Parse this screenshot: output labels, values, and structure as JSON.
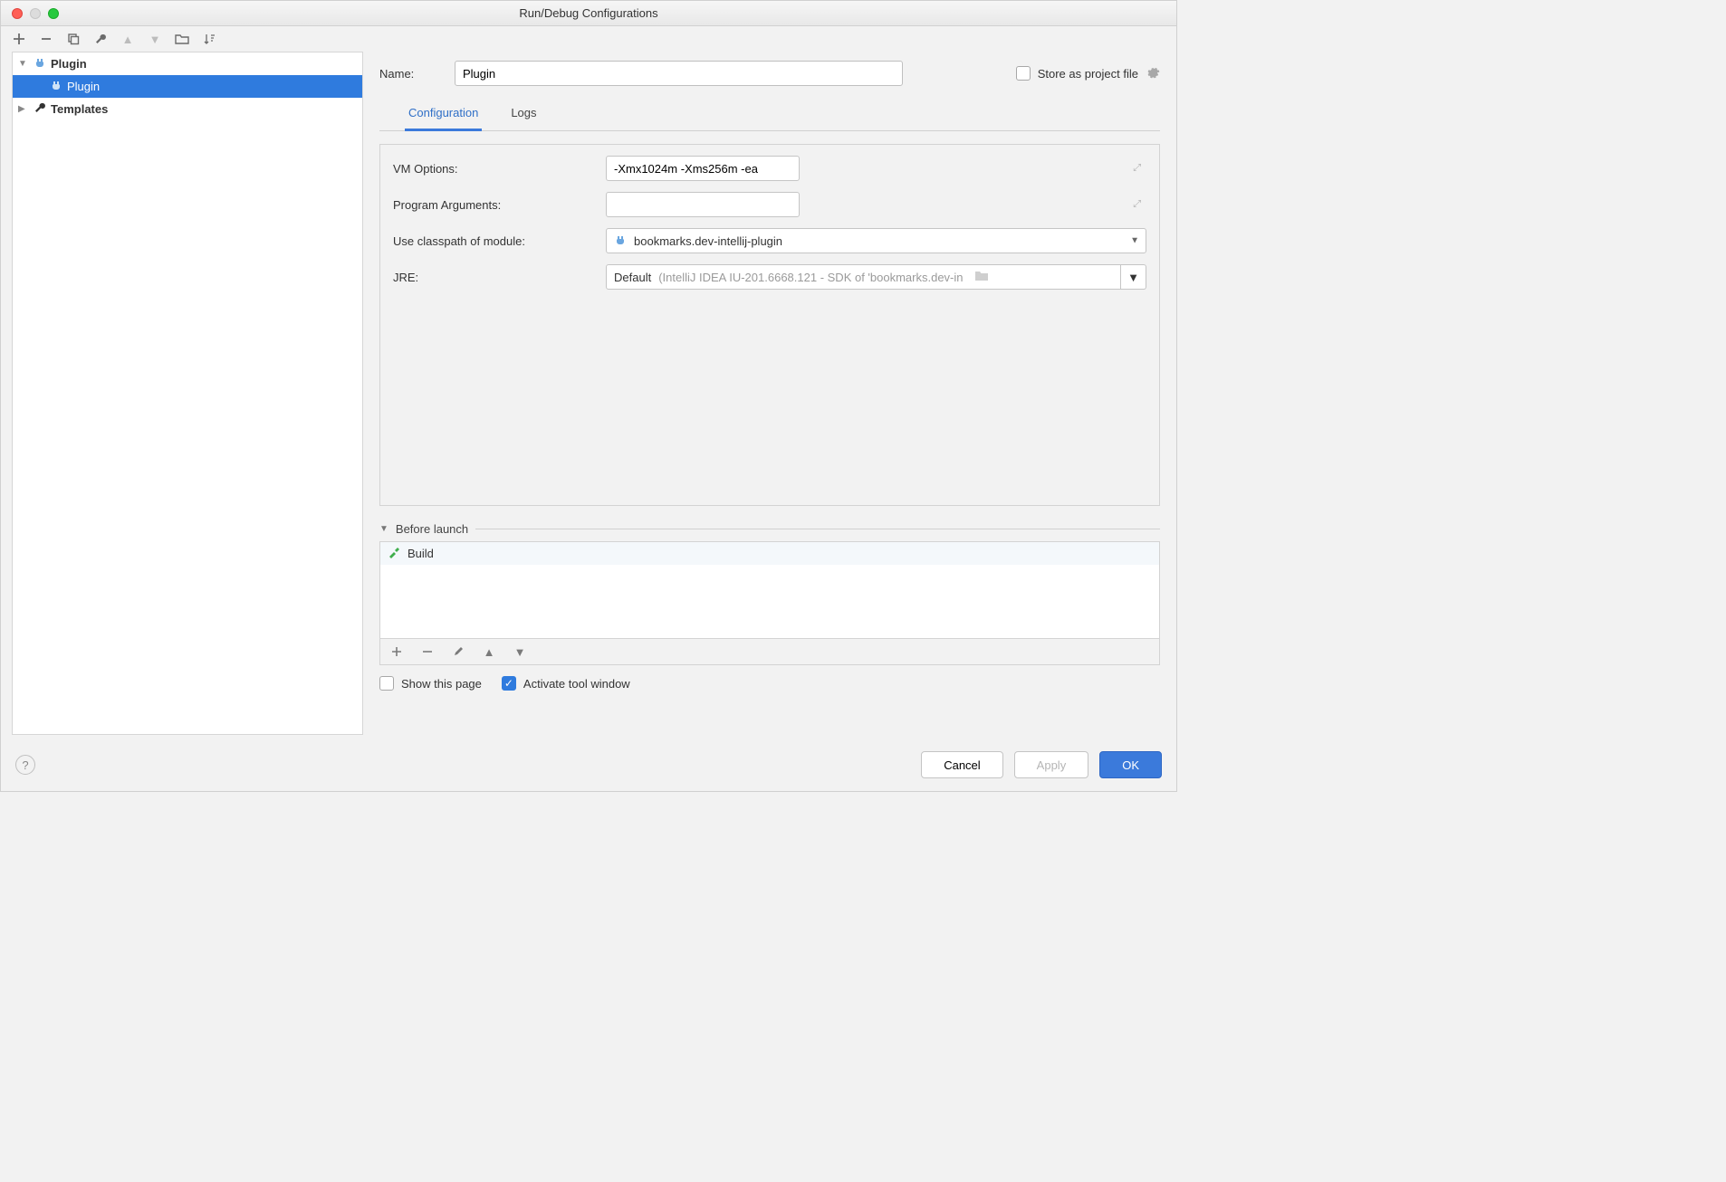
{
  "window": {
    "title": "Run/Debug Configurations"
  },
  "sidebar": {
    "items": [
      {
        "label": "Plugin",
        "type": "group"
      },
      {
        "label": "Plugin",
        "type": "child"
      },
      {
        "label": "Templates",
        "type": "group"
      }
    ]
  },
  "name_row": {
    "label": "Name:",
    "value": "Plugin",
    "store_label": "Store as project file"
  },
  "tabs": {
    "configuration": "Configuration",
    "logs": "Logs"
  },
  "form": {
    "vm_label": "VM Options:",
    "vm_value": "-Xmx1024m -Xms256m -ea",
    "args_label": "Program Arguments:",
    "args_value": "",
    "module_label": "Use classpath of module:",
    "module_value": "bookmarks.dev-intellij-plugin",
    "jre_label": "JRE:",
    "jre_default": "Default",
    "jre_hint": "(IntelliJ IDEA IU-201.6668.121 - SDK of 'bookmarks.dev-in"
  },
  "before_launch": {
    "title": "Before launch",
    "item": "Build"
  },
  "checks": {
    "show_page": "Show this page",
    "activate": "Activate tool window"
  },
  "footer": {
    "cancel": "Cancel",
    "apply": "Apply",
    "ok": "OK"
  }
}
